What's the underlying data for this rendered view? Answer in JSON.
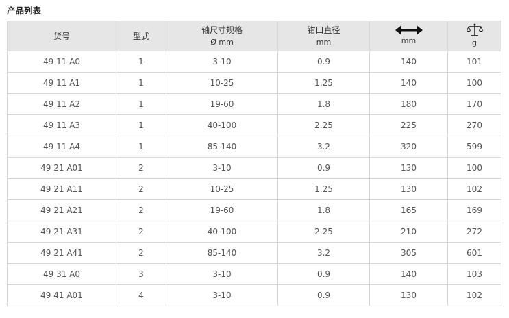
{
  "title": "产品列表",
  "table": {
    "headers": [
      {
        "line1": "货号",
        "line2": ""
      },
      {
        "line1": "型式",
        "line2": ""
      },
      {
        "line1": "轴尺寸规格",
        "line2": "Ø mm"
      },
      {
        "line1": "钳口直径",
        "line2": "mm"
      },
      {
        "icon": "double-arrow-icon",
        "line2": "mm"
      },
      {
        "icon": "scale-icon",
        "line2": "g"
      }
    ],
    "rows": [
      [
        "49 11 A0",
        "1",
        "3-10",
        "0.9",
        "140",
        "101"
      ],
      [
        "49 11 A1",
        "1",
        "10-25",
        "1.25",
        "140",
        "100"
      ],
      [
        "49 11 A2",
        "1",
        "19-60",
        "1.8",
        "180",
        "170"
      ],
      [
        "49 11 A3",
        "1",
        "40-100",
        "2.25",
        "225",
        "270"
      ],
      [
        "49 11 A4",
        "1",
        "85-140",
        "3.2",
        "320",
        "599"
      ],
      [
        "49 21 A01",
        "2",
        "3-10",
        "0.9",
        "130",
        "100"
      ],
      [
        "49 21 A11",
        "2",
        "10-25",
        "1.25",
        "130",
        "102"
      ],
      [
        "49 21 A21",
        "2",
        "19-60",
        "1.8",
        "165",
        "169"
      ],
      [
        "49 21 A31",
        "2",
        "40-100",
        "2.25",
        "210",
        "272"
      ],
      [
        "49 21 A41",
        "2",
        "85-140",
        "3.2",
        "305",
        "601"
      ],
      [
        "49 31 A0",
        "3",
        "3-10",
        "0.9",
        "140",
        "103"
      ],
      [
        "49 41 A01",
        "4",
        "3-10",
        "0.9",
        "130",
        "102"
      ]
    ]
  },
  "colors": {
    "header_bg": "#e6e6e6",
    "border": "#d6d6d6",
    "text": "#555555",
    "title": "#222222"
  }
}
